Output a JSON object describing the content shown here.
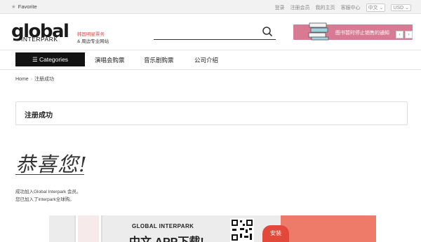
{
  "topbar": {
    "favorite": "Favorite",
    "links": [
      "登录",
      "注册会员",
      "我的主页",
      "客服中心"
    ],
    "language": "中文",
    "currency": "USD"
  },
  "header": {
    "logo_main": "global",
    "logo_sub": "INTERPARK",
    "logo_tag1": "韩国明星票务",
    "logo_tag2": "& 周边专业网站",
    "search_value": "",
    "banner_text": "图书暂时停止销售的通知"
  },
  "nav": {
    "categories": "Categories",
    "items": [
      "演唱会购票",
      "音乐剧购票",
      "公司介绍"
    ]
  },
  "breadcrumb": {
    "home": "Home",
    "current": "注册成功"
  },
  "page": {
    "title": "注册成功",
    "congrats": "恭喜您!",
    "message1": "成功加入Global Interpark 会员。",
    "message2": "您已加入了interpark全球购。"
  },
  "promo": {
    "brand": "GLOBAL INTERPARK",
    "headline": "中文 APP下载!",
    "button": "安装"
  },
  "colors": {
    "banner": "#d87a93",
    "category_button": "#121212",
    "promo_accent": "#ee7a6a"
  }
}
